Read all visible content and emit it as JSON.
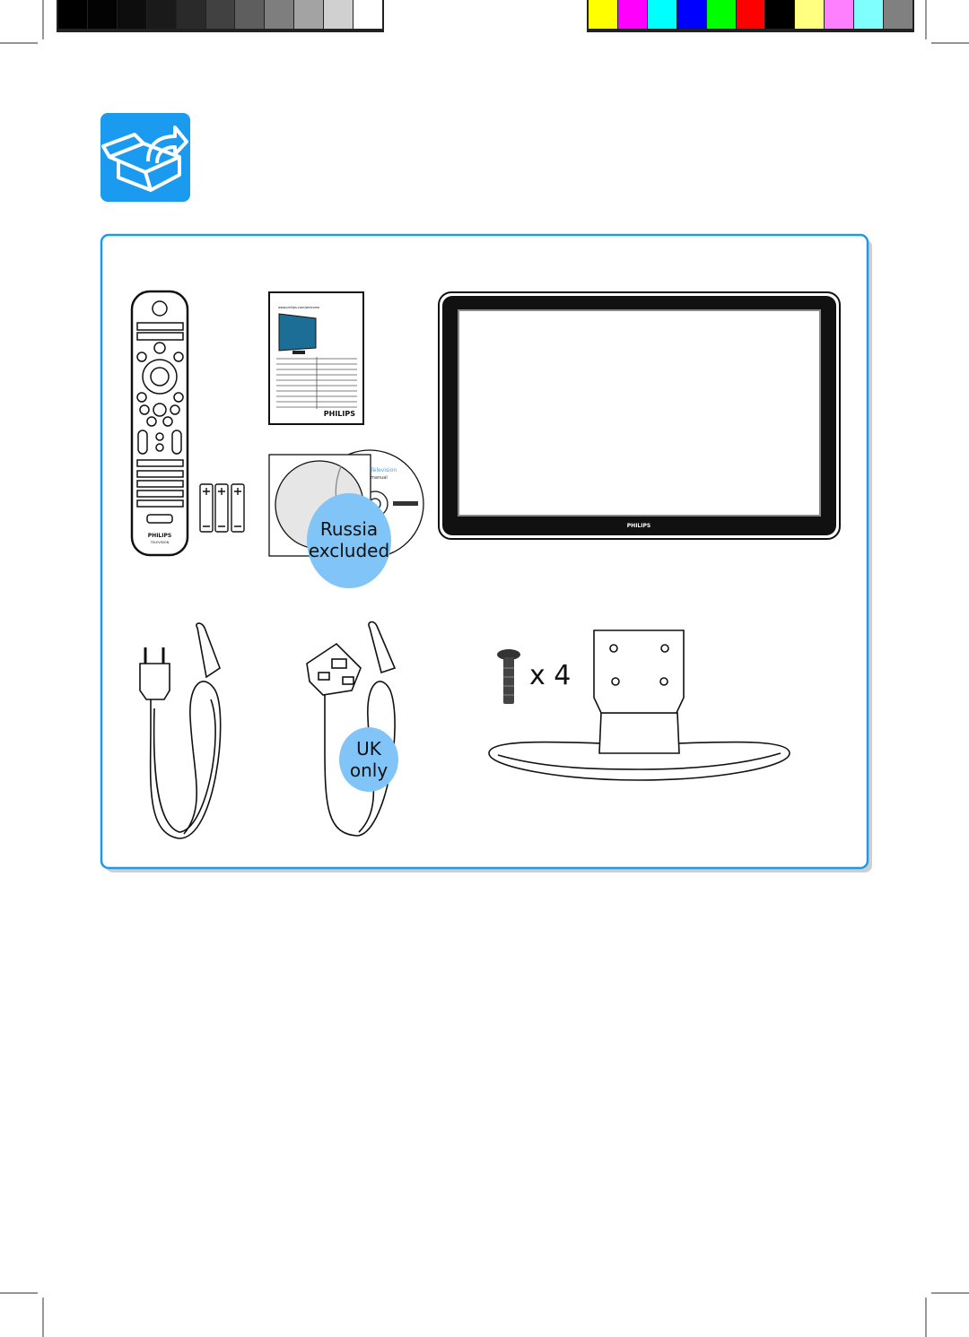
{
  "calibration": {
    "grayscale": [
      "#000000",
      "#030303",
      "#0d0d0d",
      "#1a1a1a",
      "#2a2a2a",
      "#414141",
      "#5e5e5e",
      "#7e7e7e",
      "#a3a3a3",
      "#d0d0d0",
      "#ffffff"
    ],
    "colors": [
      "#ffff00",
      "#ff00ff",
      "#00ffff",
      "#0000ff",
      "#00ff00",
      "#ff0000",
      "#000000",
      "#ffff80",
      "#ff80ff",
      "#80ffff",
      "#808080"
    ]
  },
  "accent_color": "#1a9bf0",
  "badge_color": "#80c4f8",
  "icon": "box-contents-icon",
  "items": {
    "remote": {
      "brand": "PHILIPS",
      "sub": "TELEVISION"
    },
    "manual": {
      "brand": "PHILIPS",
      "url": "www.philips.com/welcome"
    },
    "cd": {
      "title": "Television",
      "subtitle": "manual",
      "badge_line1": "Russia",
      "badge_line2": "excluded"
    },
    "tv": {
      "brand": "PHILIPS"
    },
    "uk_cord": {
      "badge_line1": "UK",
      "badge_line2": "only"
    },
    "screws": {
      "count_label": "x 4"
    }
  }
}
